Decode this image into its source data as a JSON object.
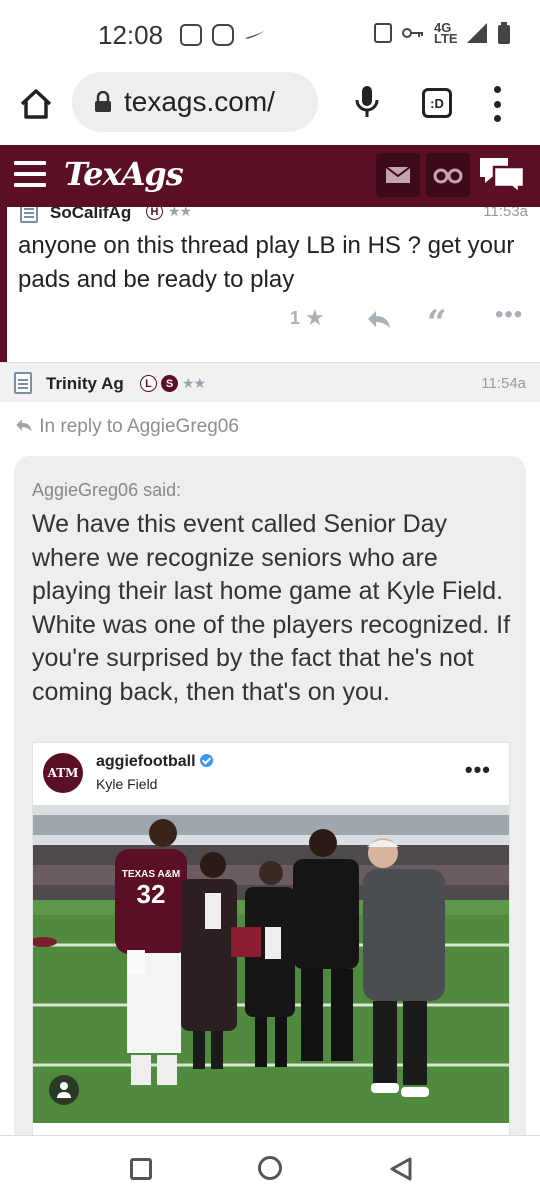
{
  "status_bar": {
    "time": "12:08",
    "network": "4G LTE"
  },
  "browser": {
    "url": "texags.com/",
    "tab_label": ":D"
  },
  "header": {
    "logo": "TexAgs"
  },
  "posts": [
    {
      "author": "SoCalifAg",
      "badges": [
        "H"
      ],
      "stars": "★★",
      "time": "11:53a",
      "body": "anyone on this thread play LB in HS ? get your pads and be ready to play",
      "likes": "1"
    },
    {
      "author": "Trinity Ag",
      "badges": [
        "L",
        "S"
      ],
      "stars": "★★",
      "time": "11:54a",
      "reply_to": "In reply to AggieGreg06",
      "quote": {
        "author": "AggieGreg06 said:",
        "text": "We have this event called Senior Day where we recognize seniors who are playing their last home game at Kyle Field. White was one of the players recognized. If you're surprised by the fact that he's not coming back, then that's on you."
      },
      "embed": {
        "username": "aggiefootball",
        "location": "Kyle Field",
        "avatar_text": "ATM"
      }
    }
  ],
  "colors": {
    "maroon": "#5a0f24",
    "maroon_dark": "#3d0a19"
  },
  "icons": {
    "home": "home-icon",
    "lock": "lock-icon",
    "mic": "mic-icon",
    "menu": "more-vert-icon",
    "hamburger": "hamburger-icon",
    "mail": "mail-icon",
    "binoculars": "binoculars-icon",
    "chat": "chat-icon",
    "star": "star-icon",
    "reply": "reply-icon",
    "quote": "quote-icon",
    "more": "more-horiz-icon"
  }
}
